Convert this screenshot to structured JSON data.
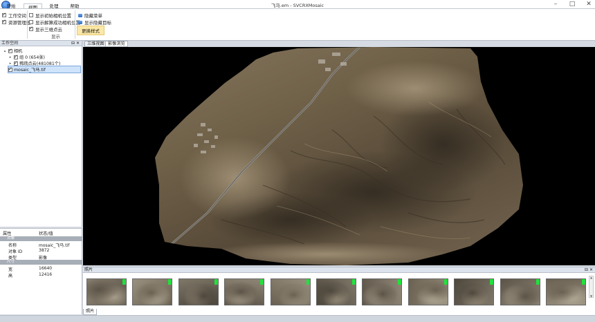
{
  "window": {
    "title": "飞马.em - SVCRXMosaic"
  },
  "ribbon_tabs": [
    {
      "label": "开始"
    },
    {
      "label": "视图",
      "active": true
    },
    {
      "label": "处理"
    },
    {
      "label": "帮助"
    }
  ],
  "ribbon": {
    "panel_toggles": [
      {
        "label": "工作空间",
        "checked": true
      },
      {
        "label": "资源管理器",
        "checked": true
      }
    ],
    "display_options": [
      {
        "label": "显示初始相机位置",
        "checked": false
      },
      {
        "label": "显示解算成功相机位置",
        "checked": false
      },
      {
        "label": "显示三维点云",
        "checked": true
      }
    ],
    "display_group_label": "显示",
    "buttons": {
      "hide_menu": "隐藏菜单",
      "show_hidden_path": "显示隐藏目标",
      "change_style": "更换样式"
    }
  },
  "workspace": {
    "title": "工作空间",
    "tree": [
      {
        "label": "相机",
        "level": 0,
        "checked": true,
        "expanded": true
      },
      {
        "label": "组 0 (654张)",
        "level": 1,
        "checked": true,
        "expanded": false
      },
      {
        "label": "稀疏点云(481081个)",
        "level": 1,
        "checked": true,
        "expanded": false
      },
      {
        "label": "mosaic_飞马.tif",
        "level": 0,
        "checked": true,
        "selected": true
      }
    ]
  },
  "properties": {
    "header_key": "属性",
    "header_value": "状态/值",
    "sections": [
      {
        "name": "对象",
        "rows": [
          {
            "key": "名称",
            "value": "mosaic_飞马.tif"
          },
          {
            "key": "对象 ID",
            "value": "3872"
          },
          {
            "key": "类型",
            "value": "影像"
          }
        ]
      },
      {
        "name": "尺寸",
        "rows": [
          {
            "key": "宽",
            "value": "16640"
          },
          {
            "key": "高",
            "value": "12416"
          }
        ]
      }
    ]
  },
  "view_tabs": [
    {
      "label": "三维视图",
      "active": false
    },
    {
      "label": "影像浏览",
      "active": true
    }
  ],
  "photos": {
    "title": "照片",
    "count_visible": 11,
    "bottom_tab": "照片"
  },
  "colors": {
    "accent": "#2f6fc4",
    "highlight": "#fce8a6",
    "thumb_flag": "#22e03c",
    "viewport_bg": "#000000"
  }
}
